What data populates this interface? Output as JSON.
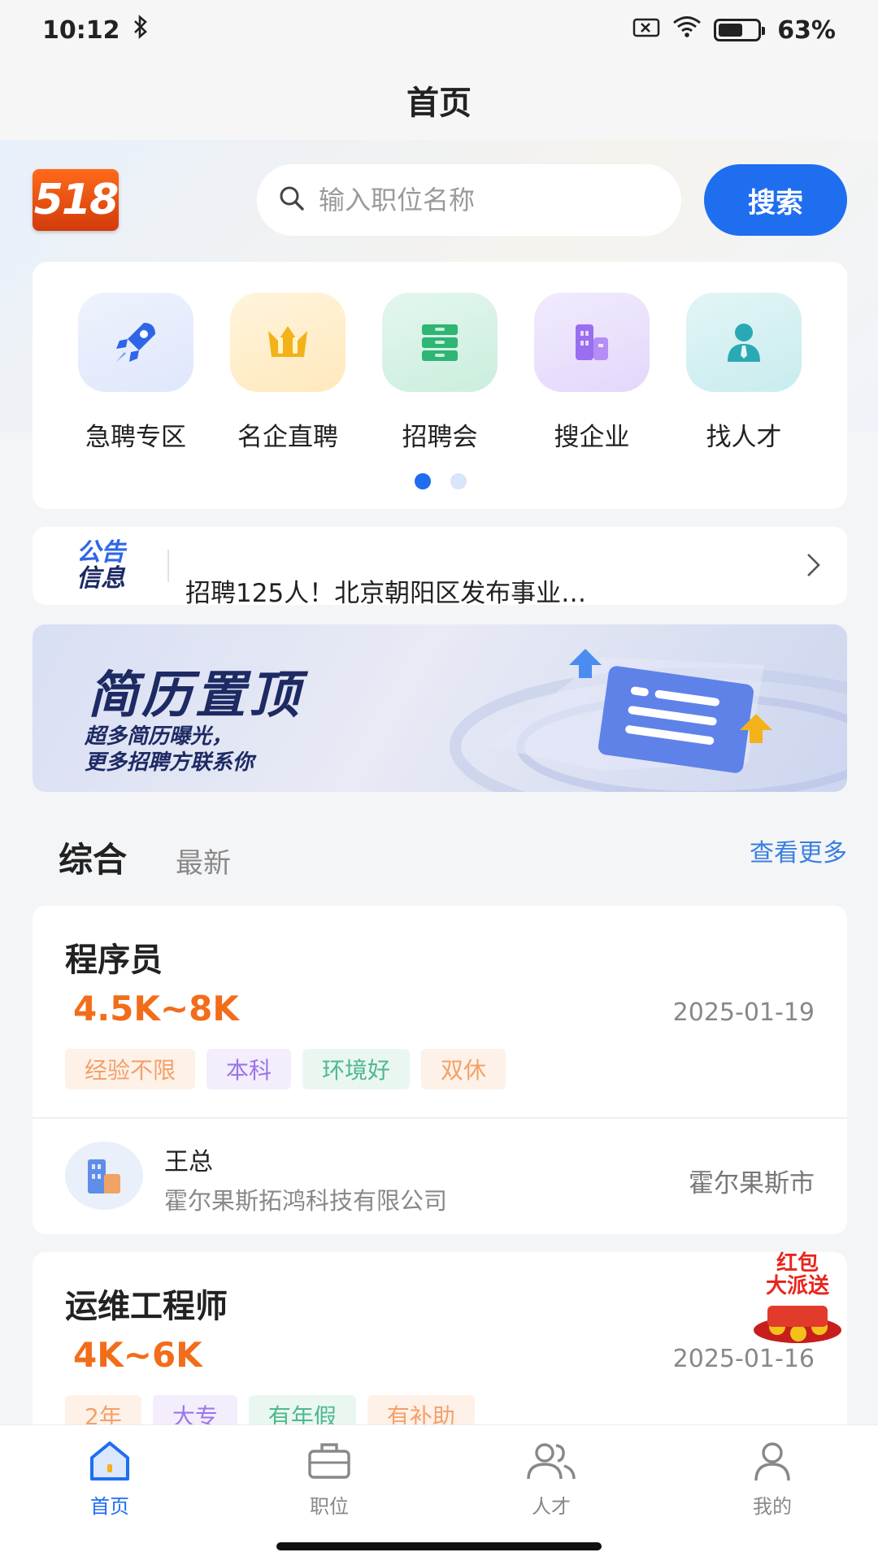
{
  "status": {
    "time": "10:12",
    "battery": "63%",
    "battery_level": 0.63
  },
  "header": {
    "title": "首页"
  },
  "logo": {
    "text": "518"
  },
  "search": {
    "placeholder": "输入职位名称",
    "button_label": "搜索"
  },
  "categories": [
    {
      "label": "急聘专区",
      "icon": "rocket-icon"
    },
    {
      "label": "名企直聘",
      "icon": "crown-icon"
    },
    {
      "label": "招聘会",
      "icon": "drawer-icon"
    },
    {
      "label": "搜企业",
      "icon": "building-icon"
    },
    {
      "label": "找人才",
      "icon": "person-icon"
    }
  ],
  "carousel": {
    "pages": 2,
    "active": 1
  },
  "notice": {
    "badge_line1": "公告",
    "badge_line2": "信息",
    "text": "招聘125人！北京朝阳区发布事业…"
  },
  "banner": {
    "title": "简历置顶",
    "subtitle_line1": "超多简历曝光，",
    "subtitle_line2": "更多招聘方联系你"
  },
  "feed_tabs": {
    "active": "综合",
    "other": "最新",
    "more": "查看更多"
  },
  "jobs": [
    {
      "title": "程序员",
      "salary": "4.5K~8K",
      "date": "2025-01-19",
      "tags": [
        "经验不限",
        "本科",
        "环境好",
        "双休"
      ],
      "contact": "王总",
      "company": "霍尔果斯拓鸿科技有限公司",
      "city": "霍尔果斯市"
    },
    {
      "title": "运维工程师",
      "salary": "4K~6K",
      "date": "2025-01-16",
      "tags": [
        "2年",
        "大专",
        "有年假",
        "有补助"
      ]
    }
  ],
  "red_packet": {
    "line1": "红包",
    "line2": "大派送"
  },
  "bottom_nav": [
    {
      "label": "首页",
      "icon": "home-icon",
      "active": true
    },
    {
      "label": "职位",
      "icon": "briefcase-icon",
      "active": false
    },
    {
      "label": "人才",
      "icon": "people-icon",
      "active": false
    },
    {
      "label": "我的",
      "icon": "user-icon",
      "active": false
    }
  ],
  "colors": {
    "primary": "#1f6ef0",
    "salary": "#f26d1a",
    "link": "#3a7fe0",
    "tag_orange": "#f5a06a",
    "tag_purple": "#9a76e8",
    "tag_green": "#4fb88e"
  }
}
